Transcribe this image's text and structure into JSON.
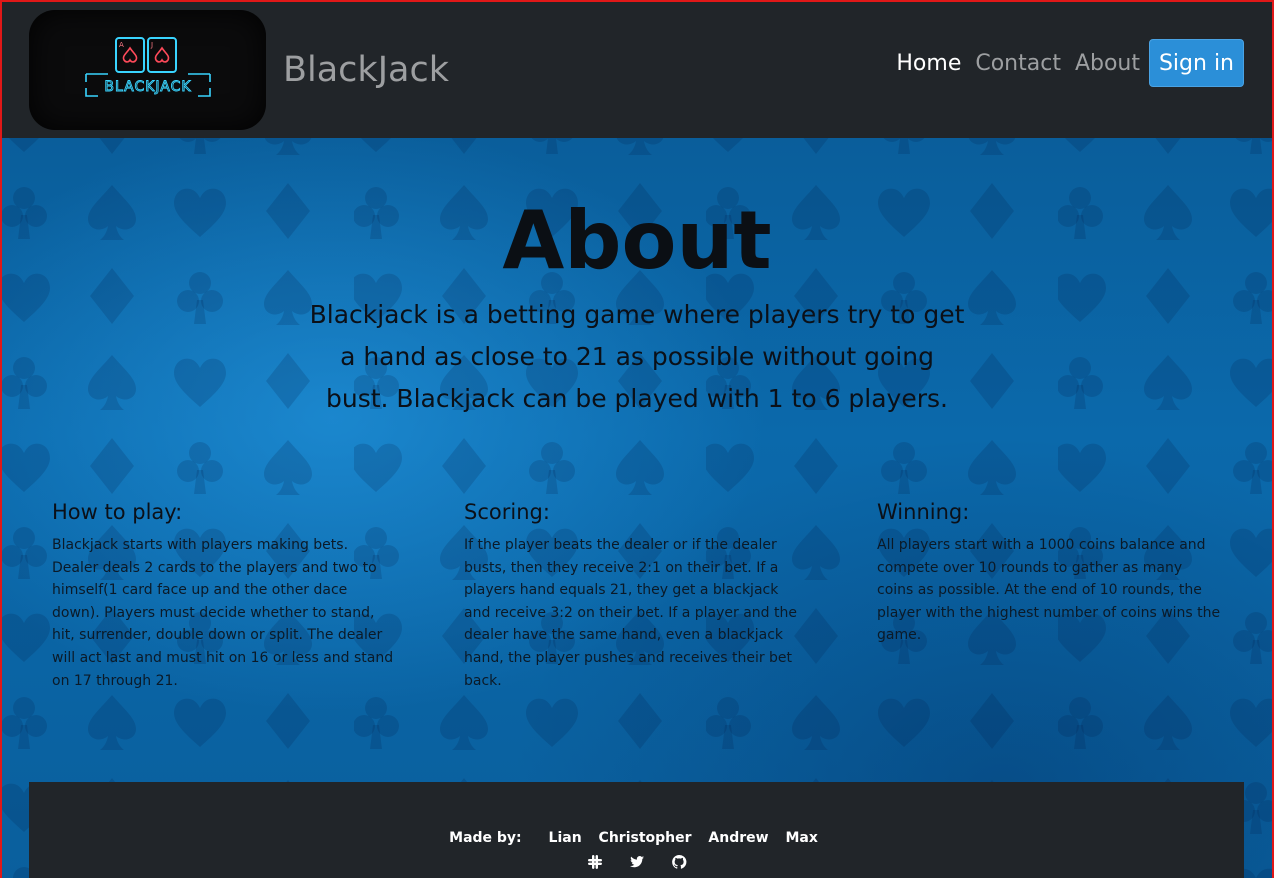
{
  "navbar": {
    "logo_text": "BLACKJACK",
    "brand": "BlackJack",
    "links": [
      "Home",
      "Contact",
      "About"
    ],
    "active_link": "Home",
    "signin_label": "Sign in"
  },
  "hero": {
    "title": "About",
    "description": "Blackjack is a betting game where players try to get a hand as close to 21 as possible without going bust. Blackjack can be played with 1 to 6 players."
  },
  "sections": [
    {
      "heading": "How to play:",
      "body": "Blackjack starts with players making bets. Dealer deals 2 cards to the players and two to himself(1 card face up and the other dace down). Players must decide whether to stand, hit, surrender, double down or split. The dealer will act last and must hit on 16 or less and stand on 17 through 21."
    },
    {
      "heading": "Scoring:",
      "body": "If the player beats the dealer or if the dealer busts, then they receive 2:1 on their bet. If a players hand equals 21, they get a blackjack and receive 3:2 on their bet. If a player and the dealer have the same hand, even a blackjack hand, the player pushes and receives their bet back."
    },
    {
      "heading": "Winning:",
      "body": "All players start with a 1000 coins balance and compete over 10 rounds to gather as many coins as possible. At the end of 10 rounds, the player with the highest number of coins wins the game."
    }
  ],
  "footer": {
    "made_by_label": "Made by:",
    "authors": [
      "Lian",
      "Christopher",
      "Andrew",
      "Max"
    ],
    "icons": [
      "slack-icon",
      "twitter-icon",
      "github-icon"
    ]
  },
  "colors": {
    "navbar_bg": "#212529",
    "accent": "#2b8fd8",
    "page_border": "#e01818",
    "hero_bg": "#0a5d98"
  }
}
